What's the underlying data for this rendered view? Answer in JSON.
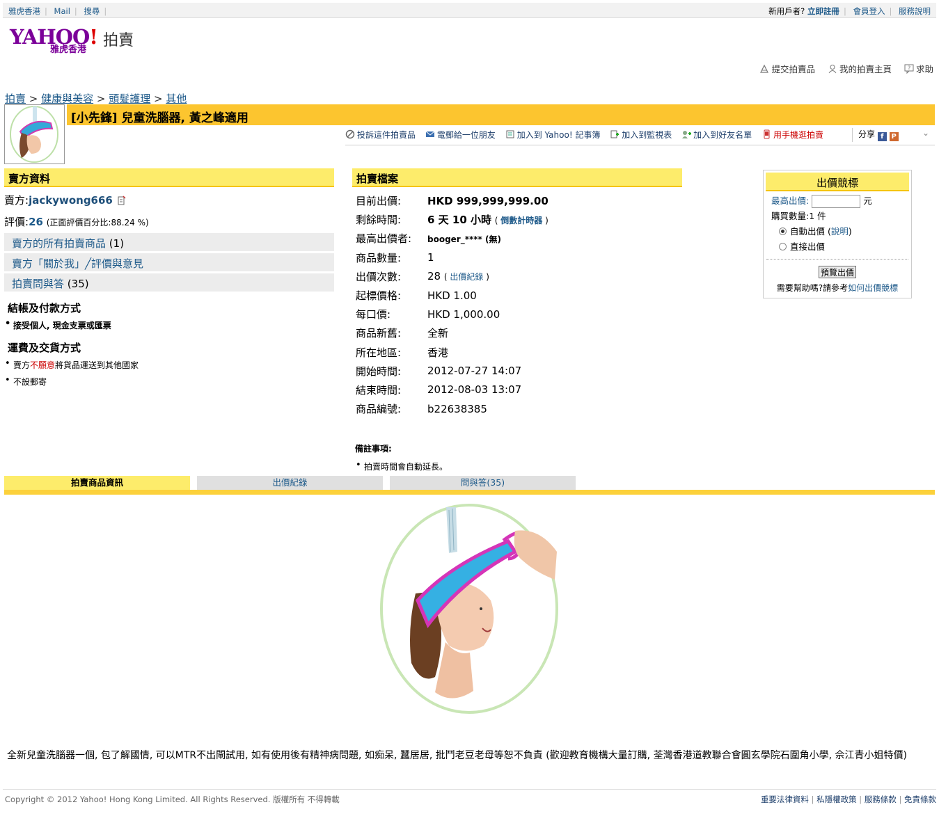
{
  "topbar": {
    "left_links": [
      "雅虎香港",
      "Mail",
      "搜尋"
    ],
    "new_user": "新用戶者?",
    "register": "立即註冊",
    "login": "會員登入",
    "service": "服務說明"
  },
  "logo": {
    "yahoo": "YAHOO",
    "excl": "!",
    "hk": "雅虎香港",
    "auction": "拍賣"
  },
  "actions": [
    "提交拍賣品",
    "我的拍賣主頁",
    "求助"
  ],
  "breadcrumb": [
    "拍賣",
    "健康與美容",
    "頭髮護理",
    "其他"
  ],
  "title": "[小先鋒] 兒童洗腦器, 黃之峰適用",
  "toolbar": {
    "report": "投訴這件拍賣品",
    "email": "電郵給一位朋友",
    "notebook": "加入到 Yahoo! 記事簿",
    "watchlist": "加入到監視表",
    "friends": "加入到好友名單",
    "mobile": "用手機逛拍賣",
    "share": "分享"
  },
  "seller": {
    "header": "賣方資料",
    "seller_label": "賣方:",
    "seller_name": "jackywong666",
    "rating_label": "評價:",
    "rating_value": "26",
    "rating_pct": "(正面評價百分比:88.24 %)",
    "links": [
      {
        "label": "賣方的所有拍賣商品",
        "count": "(1)"
      },
      {
        "label": "賣方「關於我」╱評價與意見",
        "count": ""
      },
      {
        "label": "拍賣問與答",
        "count": "(35)"
      }
    ],
    "payment_header": "結帳及付款方式",
    "payment_item": "接受個人, 現金支票或匯票",
    "shipping_header": "運費及交貨方式",
    "shipping_prefix": "賣方",
    "shipping_red": "不願意",
    "shipping_suffix": "將貨品運送到其他國家",
    "shipping_item2": "不設郵寄"
  },
  "auction": {
    "header": "拍賣檔案",
    "current_bid_label": "目前出價:",
    "current_bid": "HKD 999,999,999.00",
    "time_left_label": "剩餘時間:",
    "time_left": "6 天 10 小時",
    "countdown": "倒數計時器",
    "top_bidder_label": "最高出價者:",
    "top_bidder": "booger_**** (無)",
    "quantity_label": "商品數量:",
    "quantity": "1",
    "bids_label": "出價次數:",
    "bids": "28",
    "bid_history": "出價紀錄",
    "start_price_label": "起標價格:",
    "start_price": "HKD 1.00",
    "increment_label": "每口價:",
    "increment": "HKD 1,000.00",
    "condition_label": "商品新舊:",
    "condition": "全新",
    "location_label": "所在地區:",
    "location": "香港",
    "start_time_label": "開始時間:",
    "start_time": "2012-07-27 14:07",
    "end_time_label": "結束時間:",
    "end_time": "2012-08-03 13:07",
    "item_id_label": "商品編號:",
    "item_id": "b22638385",
    "notes_header": "備註事項:",
    "note_item": "拍賣時間會自動延長。"
  },
  "bidbox": {
    "header": "出價競標",
    "max_bid_label": "最高出價:",
    "max_bid_value": "",
    "currency": "元",
    "qty_label": "購買數量:",
    "qty_value": "1 件",
    "auto_bid": "自動出價",
    "explain": "說明",
    "direct_bid": "直接出價",
    "preview_button": "預覽出價",
    "help_text": "需要幫助嗎?請參考",
    "help_link": "如何出價競標"
  },
  "tabs": [
    "拍賣商品資訊",
    "出價紀錄",
    "問與答(35)"
  ],
  "description": "全新兒童洗腦器一個, 包了解國情, 可以MTR不出閘試用, 如有使用後有精神病問題, 如痴呆, 蠶居居, 批鬥老豆老母等恕不負責 (歡迎教育機構大量訂購, 荃灣香港道教聯合會圓玄學院石圍角小學, 佘江青小姐特價)",
  "footer": {
    "copyright": "Copyright © 2012 Yahoo! Hong Kong Limited. All Rights Reserved. 版權所有 不得轉載",
    "links": [
      "重要法律資料",
      "私隱權政策",
      "服務條款",
      "免責條款"
    ]
  },
  "colors": {
    "yellow": "#fcc52f",
    "light_yellow": "#fdec6b",
    "link": "#1e5a8a",
    "brand": "#7b0099",
    "red": "#cc0000"
  }
}
